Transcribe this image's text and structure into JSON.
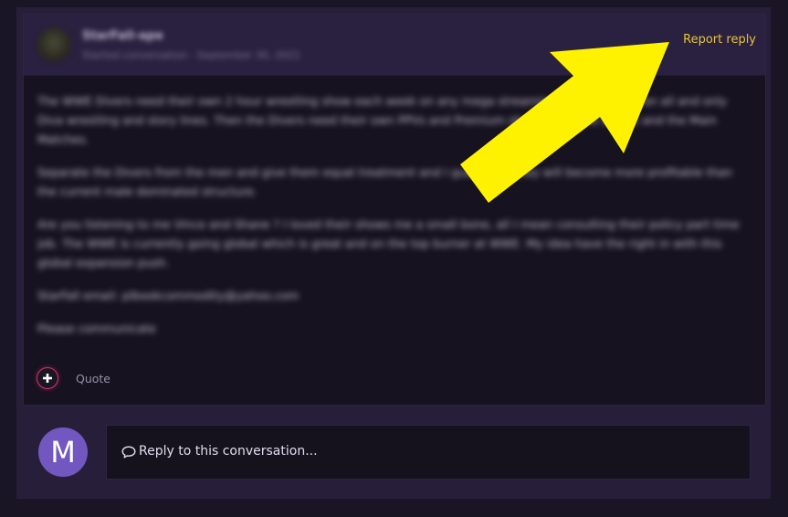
{
  "post": {
    "author_name": "StarFall-ape",
    "author_meta": "Started conversation · September 30, 2021",
    "report_label": "Report reply",
    "body": [
      "The WWE Divers need their own 2 hour wrestling show each week on any mega streaming platform, with an all and only Diva wrestling and story lines. Then the Divers need their own PPVs and Premium shows. Sign the Divers and the Main Matches.",
      "Separate the Divers from the men and give them equal treatment and I guarantee they will become more profitable than the current male dominated structure.",
      "Are you listening to me Vince and Shane ? I loved their shows me a small bone, all I mean consulting their policy part time job. The WWE is currently going global which is great and on the top burner at WWE. My idea have the right in with this global expansion push.",
      "StarFall email: plbookcommodity@yahoo.com",
      "Please communicate"
    ],
    "quote_label": "Quote",
    "react_icon": "plus-icon"
  },
  "reply": {
    "avatar_letter": "M",
    "placeholder": "Reply to this conversation...",
    "icon": "speech-bubble-icon"
  },
  "colors": {
    "accent_yellow": "#e8c33a",
    "arrow_yellow": "#fff200",
    "avatar_purple": "#7357c1",
    "react_pink": "#d6306f"
  }
}
